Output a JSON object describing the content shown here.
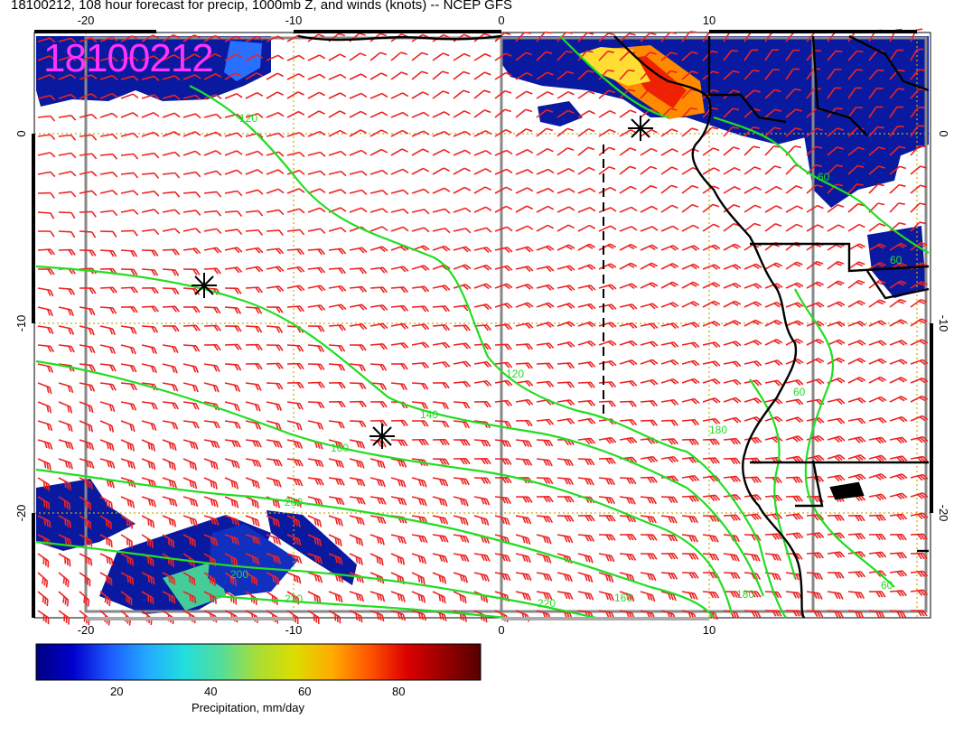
{
  "header": {
    "title": "18100212, 108 hour forecast for precip, 1000mb Z, and winds (knots) -- NCEP GFS",
    "stamp": "18100212"
  },
  "axes": {
    "lon_ticks": [
      "-20",
      "-10",
      "0",
      "10"
    ],
    "lat_ticks": [
      "0",
      "-10",
      "-20"
    ],
    "lon_range": [
      -22.5,
      20.5
    ],
    "lat_range": [
      -25.5,
      5.2
    ]
  },
  "contours": {
    "labels": [
      "120",
      "120",
      "140",
      "160",
      "160",
      "180",
      "180",
      "200",
      "200",
      "220",
      "220",
      "60",
      "60",
      "60",
      "60"
    ],
    "color": "#22dd22"
  },
  "colorbar": {
    "tick_labels": [
      "20",
      "40",
      "60",
      "80"
    ],
    "title": "Precipitation, mm/day",
    "range": [
      2,
      96
    ],
    "colors": [
      "#000080",
      "#0000cc",
      "#1e5aff",
      "#22aaff",
      "#22dddd",
      "#55dd99",
      "#aadd33",
      "#dddd00",
      "#ffaa00",
      "#ff5500",
      "#dd0000",
      "#990000",
      "#550000"
    ]
  },
  "markers": {
    "symbol": "star",
    "count": 3
  },
  "style": {
    "wind_barb_color": "#ee2222",
    "grid_color": "#ccaa00",
    "coast_color": "#000000",
    "stamp_color": "#ff33ff"
  }
}
